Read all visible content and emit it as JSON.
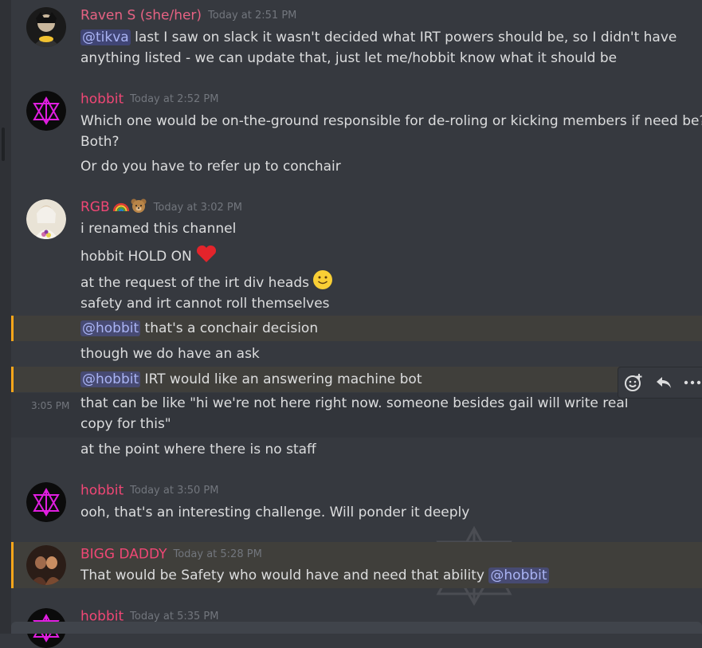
{
  "messages": [
    {
      "author": "Raven S (she/her)",
      "timestamp": "Today at 2:51 PM",
      "lines": [
        {
          "mention": "@tikva",
          "text": " last I saw on slack it wasn't decided what IRT powers should be, so I didn't have"
        },
        {
          "text": "anything listed - we can update that, just let me/hobbit know what it should be"
        }
      ]
    },
    {
      "author": "hobbit",
      "timestamp": "Today at 2:52 PM",
      "lines": [
        {
          "text": "Which one would be on-the-ground responsible for de-roling or kicking members if need be?"
        },
        {
          "text": " Both?"
        },
        {
          "text": "Or do you have to refer up to conchair"
        }
      ]
    },
    {
      "author": "RGB",
      "timestamp": "Today at 3:02 PM",
      "lines": [
        {
          "text": "i renamed this channel"
        },
        {
          "text": "hobbit HOLD ON"
        },
        {
          "text": "at the request of the irt div heads"
        },
        {
          "text": "safety and irt cannot roll themselves"
        },
        {
          "mention": "@hobbit",
          "text": " that's a conchair decision"
        },
        {
          "text": "though we do have an ask"
        },
        {
          "mention": "@hobbit",
          "text": " IRT would like an answering machine bot"
        },
        {
          "inline_time": "3:05 PM",
          "text": "that can be like \"hi we're not here right now. someone besides gail will write real copy for this\""
        },
        {
          "text": "at the point where there is no staff"
        }
      ]
    },
    {
      "author": "hobbit",
      "timestamp": "Today at 3:50 PM",
      "lines": [
        {
          "text": "ooh, that's an interesting challenge.  Will ponder it deeply"
        }
      ]
    },
    {
      "author": "BIGG DADDY",
      "timestamp": "Today at 5:28 PM",
      "lines": [
        {
          "text": "That would be Safety who would have and need that ability ",
          "mention_after": "@hobbit"
        }
      ]
    },
    {
      "author": "hobbit",
      "timestamp": "Today at 5:35 PM",
      "lines": []
    }
  ],
  "toolbar": {
    "icons": [
      "add-reaction-icon",
      "reply-icon",
      "more-icon"
    ]
  },
  "colors": {
    "background": "#36393f",
    "username": "#f04775",
    "mention": "#aab4f4",
    "highlight_bar": "#faa61a"
  }
}
